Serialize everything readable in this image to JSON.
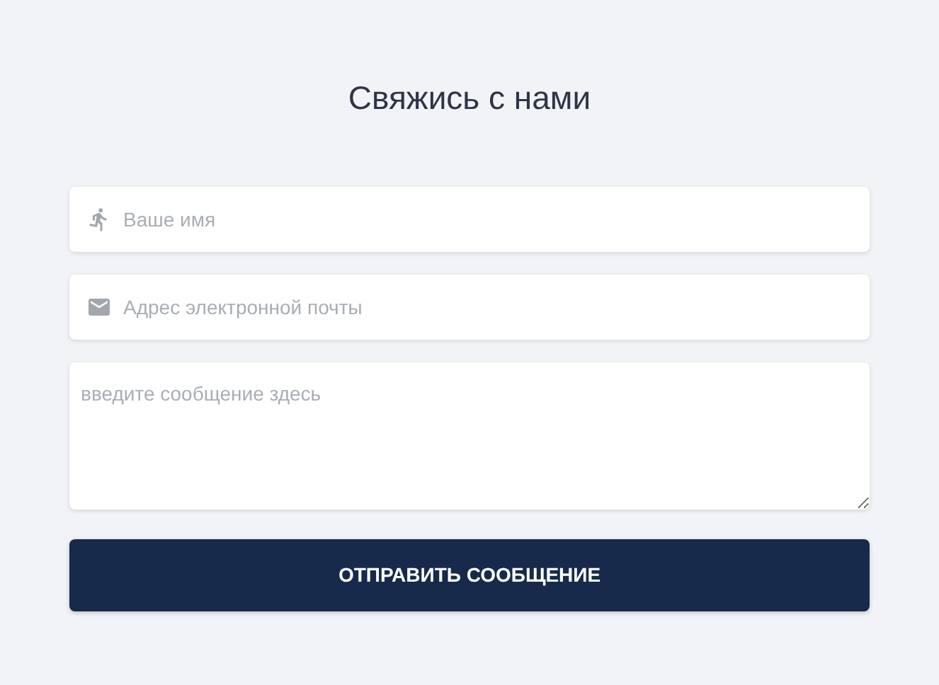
{
  "title": "Свяжись с нами",
  "fields": [
    {
      "kind": "person",
      "placeholder": "Ваше имя"
    },
    {
      "kind": "email",
      "placeholder": "Адрес электронной почты"
    },
    {
      "kind": "message",
      "placeholder": "введите сообщение здесь"
    }
  ],
  "submit_button": "ОТПРАВИТЬ СООБЩЕНИЕ"
}
